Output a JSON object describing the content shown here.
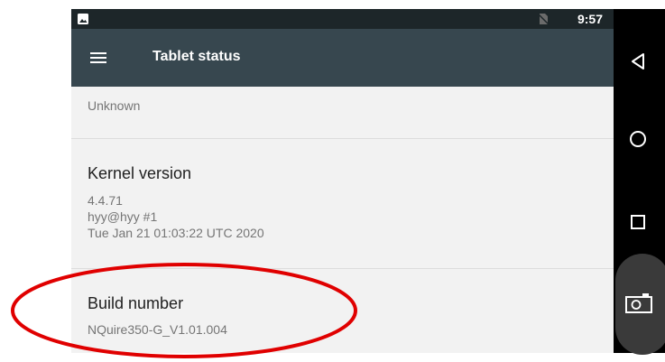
{
  "status_bar": {
    "time": "9:57"
  },
  "app_bar": {
    "title": "Tablet status",
    "menu_icon": "menu-icon"
  },
  "items": [
    {
      "value": "Unknown"
    },
    {
      "label": "Kernel version",
      "lines": [
        "4.4.71",
        "hyy@hyy #1",
        "Tue Jan 21 01:03:22 UTC 2020"
      ]
    },
    {
      "label": "Build number",
      "lines": [
        "NQuire350-G_V1.01.004"
      ]
    }
  ],
  "nav_bar": {
    "icons": [
      "back-icon",
      "home-icon",
      "recents-icon",
      "camera-icon"
    ]
  },
  "colors": {
    "app_bar": "#37474f",
    "status_bar": "#1d2629",
    "annotation": "#e00000"
  }
}
